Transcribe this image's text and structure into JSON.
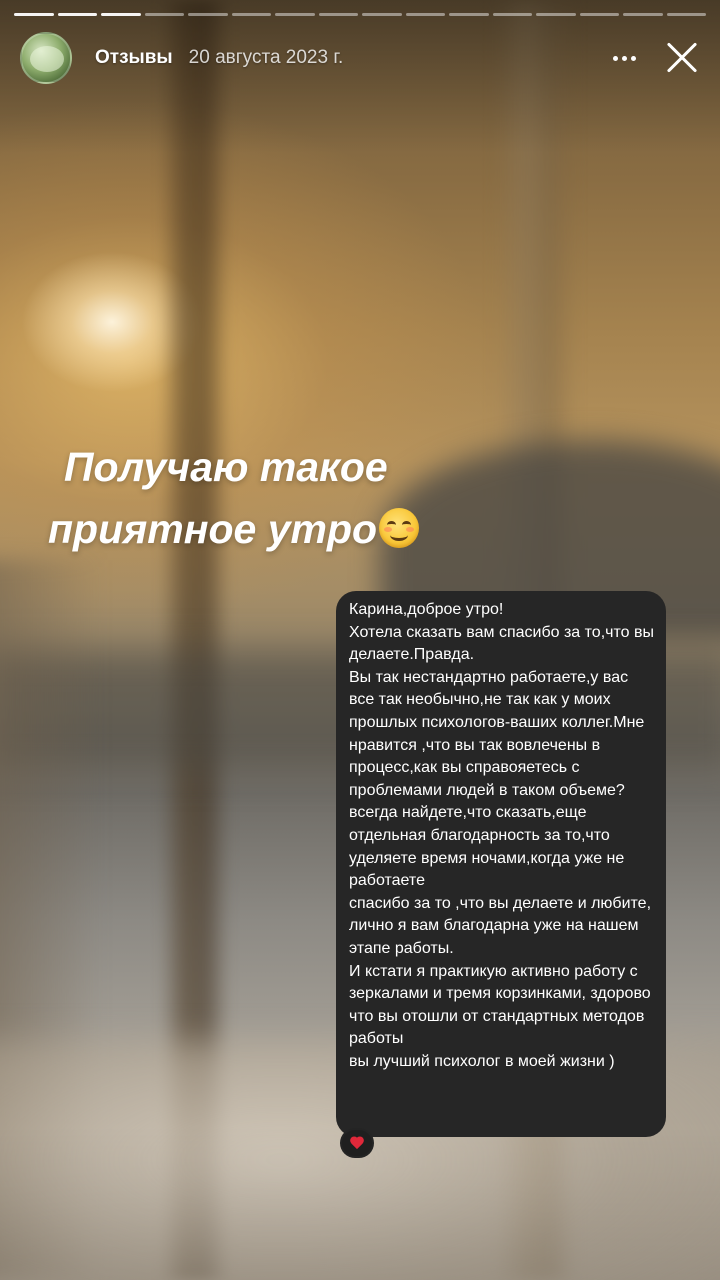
{
  "story": {
    "progress": {
      "segments_total": 16,
      "segments_viewed": 3
    }
  },
  "header": {
    "account_name": "Отзывы",
    "date": "20 августа 2023 г.",
    "avatar_icon": "highlight-cover-icon",
    "more_icon": "more-dots-icon",
    "close_icon": "close-icon"
  },
  "caption": {
    "line1": "Получаю такое",
    "line2": "приятное утро",
    "emoji": "smiling-face-emoji"
  },
  "message": {
    "text": "Карина,доброе утро!\nХотела сказать вам спасибо за то,что вы делаете.Правда.\nВы так нестандартно работаете,у вас все так необычно,не так как у моих прошлых психологов-ваших коллег.Мне нравится ,что вы так вовлечены в процесс,как вы справояетесь с проблемами людей в таком объеме?\nвсегда найдете,что сказать,еще отдельная благодарность за то,что уделяете время ночами,когда уже не работаете\nспасибо за то ,что вы делаете и любите, лично я вам благодарна уже на нашем этапе работы.\nИ кстати я практикую активно работу с зеркалами и тремя корзинками, здорово что вы отошли от стандартных методов работы\nвы лучший психолог в моей жизни )",
    "reaction": "heart-icon",
    "bubble_color": "#262626",
    "reaction_color": "#e0283a"
  }
}
